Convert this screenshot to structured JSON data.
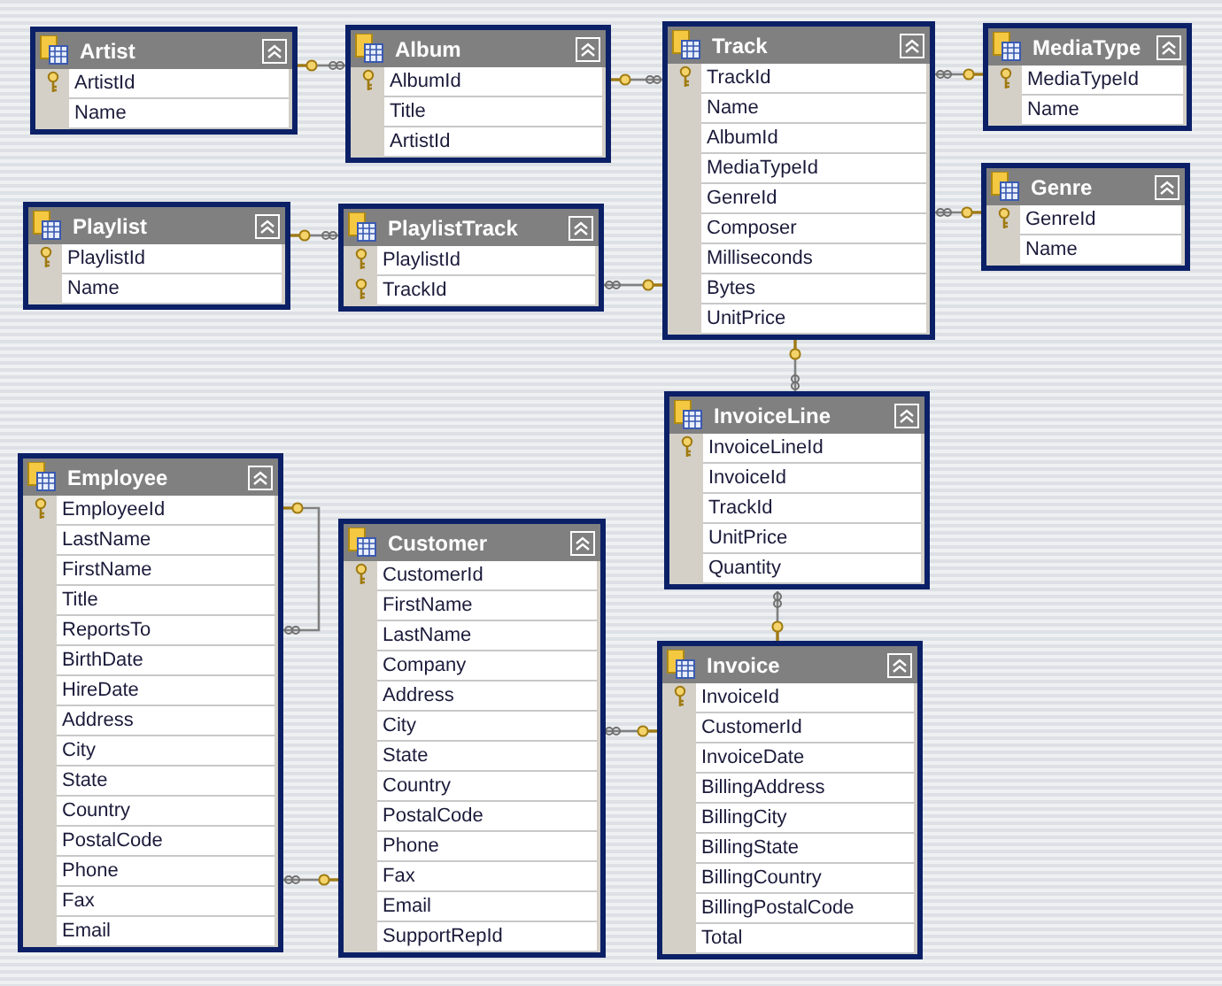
{
  "tables": [
    {
      "name": "Artist",
      "columns": [
        {
          "name": "ArtistId",
          "primary_key": true
        },
        {
          "name": "Name",
          "primary_key": false
        }
      ]
    },
    {
      "name": "Album",
      "columns": [
        {
          "name": "AlbumId",
          "primary_key": true
        },
        {
          "name": "Title",
          "primary_key": false
        },
        {
          "name": "ArtistId",
          "primary_key": false
        }
      ]
    },
    {
      "name": "Track",
      "columns": [
        {
          "name": "TrackId",
          "primary_key": true
        },
        {
          "name": "Name",
          "primary_key": false
        },
        {
          "name": "AlbumId",
          "primary_key": false
        },
        {
          "name": "MediaTypeId",
          "primary_key": false
        },
        {
          "name": "GenreId",
          "primary_key": false
        },
        {
          "name": "Composer",
          "primary_key": false
        },
        {
          "name": "Milliseconds",
          "primary_key": false
        },
        {
          "name": "Bytes",
          "primary_key": false
        },
        {
          "name": "UnitPrice",
          "primary_key": false
        }
      ]
    },
    {
      "name": "MediaType",
      "columns": [
        {
          "name": "MediaTypeId",
          "primary_key": true
        },
        {
          "name": "Name",
          "primary_key": false
        }
      ]
    },
    {
      "name": "Genre",
      "columns": [
        {
          "name": "GenreId",
          "primary_key": true
        },
        {
          "name": "Name",
          "primary_key": false
        }
      ]
    },
    {
      "name": "Playlist",
      "columns": [
        {
          "name": "PlaylistId",
          "primary_key": true
        },
        {
          "name": "Name",
          "primary_key": false
        }
      ]
    },
    {
      "name": "PlaylistTrack",
      "columns": [
        {
          "name": "PlaylistId",
          "primary_key": true
        },
        {
          "name": "TrackId",
          "primary_key": true
        }
      ]
    },
    {
      "name": "InvoiceLine",
      "columns": [
        {
          "name": "InvoiceLineId",
          "primary_key": true
        },
        {
          "name": "InvoiceId",
          "primary_key": false
        },
        {
          "name": "TrackId",
          "primary_key": false
        },
        {
          "name": "UnitPrice",
          "primary_key": false
        },
        {
          "name": "Quantity",
          "primary_key": false
        }
      ]
    },
    {
      "name": "Employee",
      "columns": [
        {
          "name": "EmployeeId",
          "primary_key": true
        },
        {
          "name": "LastName",
          "primary_key": false
        },
        {
          "name": "FirstName",
          "primary_key": false
        },
        {
          "name": "Title",
          "primary_key": false
        },
        {
          "name": "ReportsTo",
          "primary_key": false
        },
        {
          "name": "BirthDate",
          "primary_key": false
        },
        {
          "name": "HireDate",
          "primary_key": false
        },
        {
          "name": "Address",
          "primary_key": false
        },
        {
          "name": "City",
          "primary_key": false
        },
        {
          "name": "State",
          "primary_key": false
        },
        {
          "name": "Country",
          "primary_key": false
        },
        {
          "name": "PostalCode",
          "primary_key": false
        },
        {
          "name": "Phone",
          "primary_key": false
        },
        {
          "name": "Fax",
          "primary_key": false
        },
        {
          "name": "Email",
          "primary_key": false
        }
      ]
    },
    {
      "name": "Customer",
      "columns": [
        {
          "name": "CustomerId",
          "primary_key": true
        },
        {
          "name": "FirstName",
          "primary_key": false
        },
        {
          "name": "LastName",
          "primary_key": false
        },
        {
          "name": "Company",
          "primary_key": false
        },
        {
          "name": "Address",
          "primary_key": false
        },
        {
          "name": "City",
          "primary_key": false
        },
        {
          "name": "State",
          "primary_key": false
        },
        {
          "name": "Country",
          "primary_key": false
        },
        {
          "name": "PostalCode",
          "primary_key": false
        },
        {
          "name": "Phone",
          "primary_key": false
        },
        {
          "name": "Fax",
          "primary_key": false
        },
        {
          "name": "Email",
          "primary_key": false
        },
        {
          "name": "SupportRepId",
          "primary_key": false
        }
      ]
    },
    {
      "name": "Invoice",
      "columns": [
        {
          "name": "InvoiceId",
          "primary_key": true
        },
        {
          "name": "CustomerId",
          "primary_key": false
        },
        {
          "name": "InvoiceDate",
          "primary_key": false
        },
        {
          "name": "BillingAddress",
          "primary_key": false
        },
        {
          "name": "BillingCity",
          "primary_key": false
        },
        {
          "name": "BillingState",
          "primary_key": false
        },
        {
          "name": "BillingCountry",
          "primary_key": false
        },
        {
          "name": "BillingPostalCode",
          "primary_key": false
        },
        {
          "name": "Total",
          "primary_key": false
        }
      ]
    }
  ]
}
